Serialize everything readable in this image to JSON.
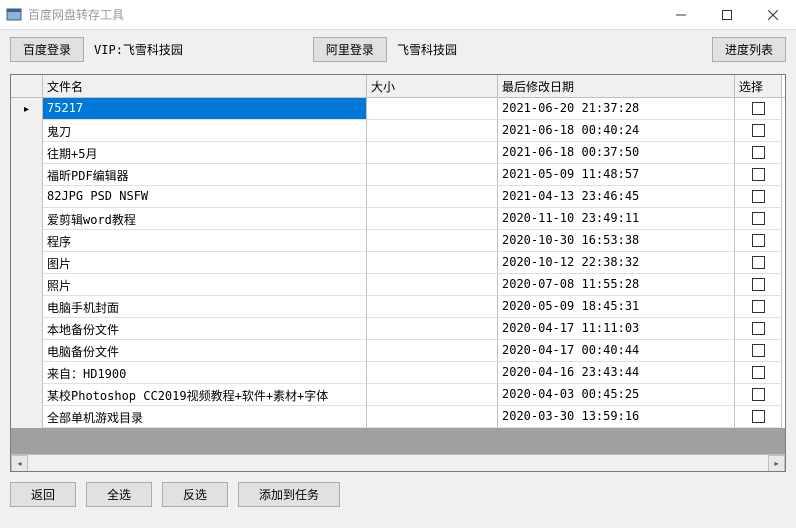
{
  "window": {
    "title": "百度网盘转存工具"
  },
  "toolbar": {
    "baidu_login": "百度登录",
    "vip_label": "VIP:飞雪科技园",
    "ali_login": "阿里登录",
    "ali_account": "飞雪科技园",
    "progress_list": "进度列表"
  },
  "columns": {
    "name": "文件名",
    "size": "大小",
    "date": "最后修改日期",
    "select": "选择"
  },
  "rows": [
    {
      "name": "75217",
      "size": "",
      "date": "2021-06-20 21:37:28",
      "selected": false,
      "current": true
    },
    {
      "name": "鬼刀",
      "size": "",
      "date": "2021-06-18 00:40:24",
      "selected": false
    },
    {
      "name": "往期+5月",
      "size": "",
      "date": "2021-06-18 00:37:50",
      "selected": false
    },
    {
      "name": "福昕PDF编辑器",
      "size": "",
      "date": "2021-05-09 11:48:57",
      "selected": false
    },
    {
      "name": "82JPG PSD NSFW",
      "size": "",
      "date": "2021-04-13 23:46:45",
      "selected": false
    },
    {
      "name": "爱剪辑word教程",
      "size": "",
      "date": "2020-11-10 23:49:11",
      "selected": false
    },
    {
      "name": "程序",
      "size": "",
      "date": "2020-10-30 16:53:38",
      "selected": false
    },
    {
      "name": "图片",
      "size": "",
      "date": "2020-10-12 22:38:32",
      "selected": false
    },
    {
      "name": "照片",
      "size": "",
      "date": "2020-07-08 11:55:28",
      "selected": false
    },
    {
      "name": "电脑手机封面",
      "size": "",
      "date": "2020-05-09 18:45:31",
      "selected": false
    },
    {
      "name": "本地备份文件",
      "size": "",
      "date": "2020-04-17 11:11:03",
      "selected": false
    },
    {
      "name": "电脑备份文件",
      "size": "",
      "date": "2020-04-17 00:40:44",
      "selected": false
    },
    {
      "name": "来自：HD1900",
      "size": "",
      "date": "2020-04-16 23:43:44",
      "selected": false
    },
    {
      "name": "某校Photoshop CC2019视频教程+软件+素材+字体",
      "size": "",
      "date": "2020-04-03 00:45:25",
      "selected": false
    },
    {
      "name": "全部单机游戏目录",
      "size": "",
      "date": "2020-03-30 13:59:16",
      "selected": false
    }
  ],
  "bottom": {
    "back": "返回",
    "select_all": "全选",
    "invert": "反选",
    "add_task": "添加到任务"
  }
}
